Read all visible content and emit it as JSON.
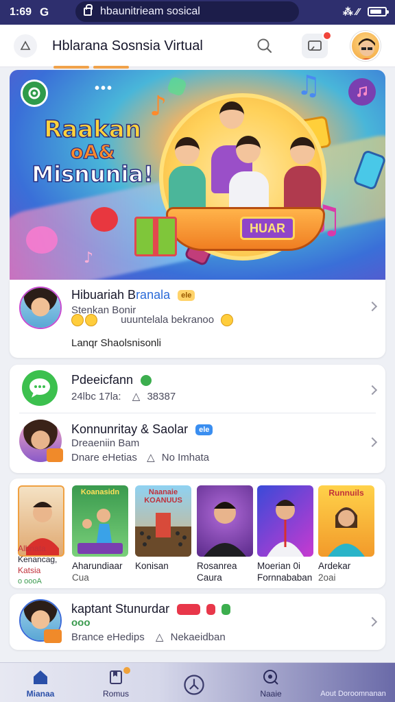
{
  "status_bar": {
    "time": "1:69",
    "network_glyph": "G",
    "url": "hbaunitrieam sosical",
    "right_glyphs": "⁂ ⁄⁄"
  },
  "header": {
    "title": "Hblarana Sosnsia Virtual",
    "home_icon": "home-outline-icon",
    "search_icon": "search-icon",
    "cast_icon": "cast-screen-icon",
    "avatar": "user-avatar"
  },
  "hero": {
    "title_lines": [
      "Raakan",
      "oA&",
      "Misnunia!"
    ],
    "stage_sign": "HUAR",
    "accent": "#ffd23c"
  },
  "featured": {
    "name": "Hibuariah B",
    "name_highlight": "ranala",
    "badge": "ele",
    "line1": "Stenkan Bonir",
    "line2": "uuuntelala bekranoo",
    "line3": "Lanqr Shaolsnisonli"
  },
  "group": [
    {
      "name": "Pdeeicfann",
      "meta_time": "24lbc 17la:",
      "meta_count": "38387"
    },
    {
      "name": "Konnunritay & Saolar",
      "badge": "ele",
      "line1": "Dreaeniin Bam",
      "line2_a": "Dnare eHetias",
      "line2_b": "No Imhata"
    }
  ],
  "rail": [
    {
      "cap1": "Albnata",
      "cap2": "Kenancag,",
      "cap3": "Katsia",
      "cap4": "o oooA"
    },
    {
      "cap1": "Aharundiaar",
      "cap2": "Cua",
      "tile_text": "Koanasidn"
    },
    {
      "cap1": "Konisan",
      "cap2": "",
      "tile_text": "Naanaie KOANUUS"
    },
    {
      "cap1": "Rosanrea",
      "cap2": "Caura"
    },
    {
      "cap1": "Moerian 0i",
      "cap2": "Fornnababan"
    },
    {
      "cap1": "Ardekar",
      "cap2": "2oai",
      "tile_text": "Runnuils"
    }
  ],
  "last_item": {
    "name": "kaptant Stunurdar",
    "line1": "ooo",
    "line2_a": "Brance eHedips",
    "line2_b": "Nekaeidban"
  },
  "bottom_nav": [
    {
      "label": "Mianaa",
      "icon": "home-icon"
    },
    {
      "label": "Romus",
      "icon": "bookmark-icon"
    },
    {
      "label": "",
      "icon": "clock-icon"
    },
    {
      "label": "Naaie",
      "icon": "chat-search-icon"
    },
    {
      "label": "Aout Doroomnanan",
      "icon": "profile-icon"
    }
  ]
}
